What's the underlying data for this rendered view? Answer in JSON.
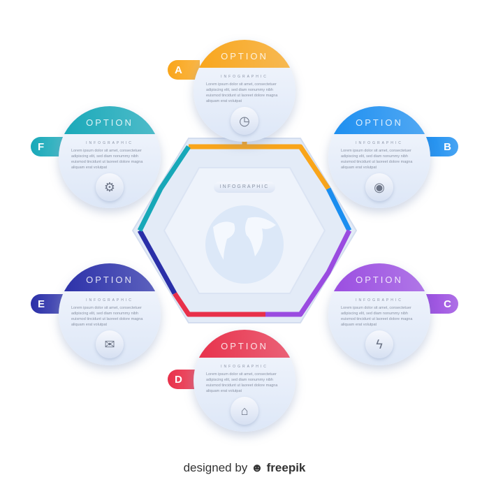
{
  "center": {
    "label": "INFOGRAPHIC",
    "icon": "globe-icon"
  },
  "options": [
    {
      "letter": "A",
      "title": "OPTION",
      "subtitle": "INFOGRAPHIC",
      "text": "Lorem ipsum dolor sit amet, consectetuer adipiscing elit, sed diam nonummy nibh euismod tincidunt ut laoreet dolore magna aliquam erat volutpat",
      "icon": "clock-icon",
      "color": "#f9a51a"
    },
    {
      "letter": "B",
      "title": "OPTION",
      "subtitle": "INFOGRAPHIC",
      "text": "Lorem ipsum dolor sit amet, consectetuer adipiscing elit, sed diam nonummy nibh euismod tincidunt ut laoreet dolore magna aliquam erat volutpat",
      "icon": "eye-icon",
      "color": "#1b8ef0"
    },
    {
      "letter": "C",
      "title": "OPTION",
      "subtitle": "INFOGRAPHIC",
      "text": "Lorem ipsum dolor sit amet, consectetuer adipiscing elit, sed diam nonummy nibh euismod tincidunt ut laoreet dolore magna aliquam erat volutpat",
      "icon": "lightning-icon",
      "color": "#9a4ce0"
    },
    {
      "letter": "D",
      "title": "OPTION",
      "subtitle": "INFOGRAPHIC",
      "text": "Lorem ipsum dolor sit amet, consectetuer adipiscing elit, sed diam nonummy nibh euismod tincidunt ut laoreet dolore magna aliquam erat volutpat",
      "icon": "home-icon",
      "color": "#e8304a"
    },
    {
      "letter": "E",
      "title": "OPTION",
      "subtitle": "INFOGRAPHIC",
      "text": "Lorem ipsum dolor sit amet, consectetuer adipiscing elit, sed diam nonummy nibh euismod tincidunt ut laoreet dolore magna aliquam erat volutpat",
      "icon": "mail-icon",
      "color": "#2a2fa8"
    },
    {
      "letter": "F",
      "title": "OPTION",
      "subtitle": "INFOGRAPHIC",
      "text": "Lorem ipsum dolor sit amet, consectetuer adipiscing elit, sed diam nonummy nibh euismod tincidunt ut laoreet dolore magna aliquam erat volutpat",
      "icon": "gear-icon",
      "color": "#17a8b8"
    }
  ],
  "footer": {
    "prefix": "designed by",
    "brand": "freepik"
  }
}
